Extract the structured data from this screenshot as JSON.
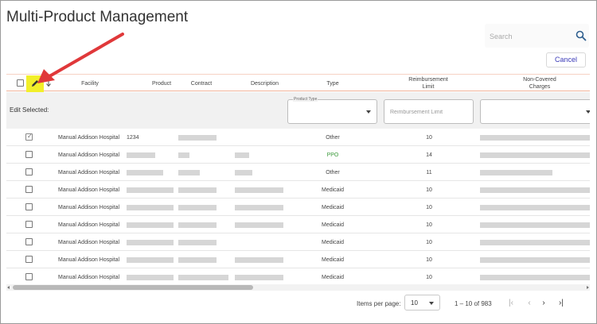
{
  "page": {
    "title": "Multi-Product Management"
  },
  "search": {
    "placeholder": "Search",
    "icon": "search-icon"
  },
  "actions": {
    "cancel_label": "Cancel"
  },
  "table": {
    "headers": {
      "facility": "Facility",
      "product": "Product",
      "contract": "Contract",
      "description": "Description",
      "type": "Type",
      "reimbursement_limit_line1": "Reimbursement",
      "reimbursement_limit_line2": "Limit",
      "non_covered_line1": "Non-Covered",
      "non_covered_line2": "Charges"
    },
    "edit_selected": {
      "label": "Edit Selected:",
      "product_type_label": "Product Type",
      "reimbursement_placeholder": "Reimbursement Limit"
    },
    "rows": [
      {
        "checked": true,
        "facility": "Manual Addison Hospital",
        "product": "1234",
        "type": "Other",
        "limit": "10"
      },
      {
        "checked": false,
        "facility": "Manual Addison Hospital",
        "product": "",
        "type": "PPO",
        "limit": "14"
      },
      {
        "checked": false,
        "facility": "Manual Addison Hospital",
        "product": "",
        "type": "Other",
        "limit": "11"
      },
      {
        "checked": false,
        "facility": "Manual Addison Hospital",
        "product": "",
        "type": "Medicaid",
        "limit": "10"
      },
      {
        "checked": false,
        "facility": "Manual Addison Hospital",
        "product": "",
        "type": "Medicaid",
        "limit": "10"
      },
      {
        "checked": false,
        "facility": "Manual Addison Hospital",
        "product": "",
        "type": "Medicaid",
        "limit": "10"
      },
      {
        "checked": false,
        "facility": "Manual Addison Hospital",
        "product": "",
        "type": "Medicaid",
        "limit": "10"
      },
      {
        "checked": false,
        "facility": "Manual Addison Hospital",
        "product": "",
        "type": "Medicaid",
        "limit": "10"
      },
      {
        "checked": false,
        "facility": "Manual Addison Hospital",
        "product": "",
        "type": "Medicaid",
        "limit": "10"
      }
    ]
  },
  "paginator": {
    "items_per_page_label": "Items per page:",
    "page_size": "10",
    "range": "1 – 10 of 983",
    "first": "|‹",
    "prev": "‹",
    "next": "›",
    "last": "›|"
  },
  "colors": {
    "accent": "#3a3ab8",
    "header_border": "#f0b39a",
    "highlight": "#f2ef29",
    "arrow": "#e0383a",
    "ppo": "#3d9b3d"
  }
}
